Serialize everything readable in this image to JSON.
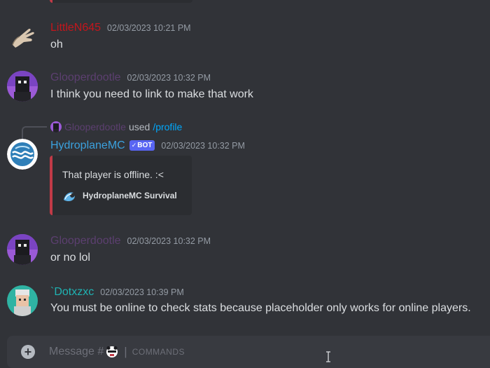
{
  "messages": [
    {
      "username": "LittleN645",
      "username_color": "#c4161c",
      "timestamp": "02/03/2023 10:21 PM",
      "content": "oh",
      "avatar_icon": "hand-avatar-icon"
    },
    {
      "username": "Glooperdootle",
      "username_color": "#5c3f70",
      "timestamp": "02/03/2023 10:32 PM",
      "content": "I think you need to link to make that work",
      "avatar_icon": "glooperdootle-avatar-icon"
    },
    {
      "username": "HydroplaneMC",
      "username_color": "#3ba1de",
      "bot_tag": "BOT",
      "timestamp": "02/03/2023 10:32 PM",
      "avatar_icon": "water-emblem-avatar-icon",
      "reply": {
        "username": "Glooperdootle",
        "verb": "used",
        "command": "/profile"
      },
      "embed": {
        "accent_color": "#c13a47",
        "description": "That player is offline. :<",
        "footer_text": "HydroplaneMC Survival",
        "footer_icon": "wave-icon"
      }
    },
    {
      "username": "Glooperdootle",
      "username_color": "#5c3f70",
      "timestamp": "02/03/2023 10:32 PM",
      "content": "or no lol",
      "avatar_icon": "glooperdootle-avatar-icon"
    },
    {
      "username": "`Dotxzxc",
      "username_color": "#1fb3b3",
      "timestamp": "02/03/2023 10:39 PM",
      "content": "You must be online to check stats because placeholder only works for online players.",
      "avatar_icon": "dotxzxc-avatar-icon"
    }
  ],
  "composer": {
    "placeholder": "Message #",
    "channel_emoji": "bear-face-emoji-icon",
    "separator": "|",
    "commands_label": "COMMANDS",
    "add_button": "+"
  }
}
